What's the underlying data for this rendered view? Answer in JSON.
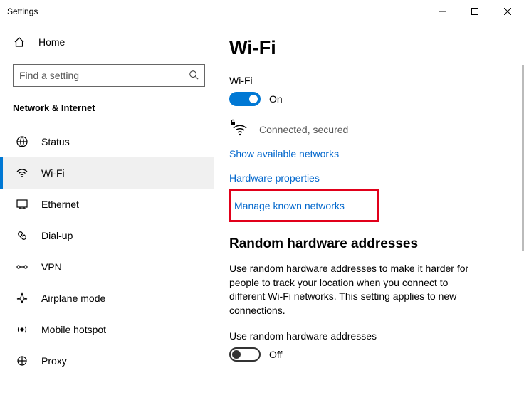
{
  "window": {
    "title": "Settings"
  },
  "sidebar": {
    "home": "Home",
    "search_placeholder": "Find a setting",
    "section": "Network & Internet",
    "items": [
      {
        "label": "Status"
      },
      {
        "label": "Wi-Fi"
      },
      {
        "label": "Ethernet"
      },
      {
        "label": "Dial-up"
      },
      {
        "label": "VPN"
      },
      {
        "label": "Airplane mode"
      },
      {
        "label": "Mobile hotspot"
      },
      {
        "label": "Proxy"
      }
    ]
  },
  "page": {
    "title": "Wi-Fi",
    "wifi_label": "Wi-Fi",
    "wifi_state": "On",
    "connection_status": "Connected, secured",
    "link_show_networks": "Show available networks",
    "link_hw_props": "Hardware properties",
    "link_manage_known": "Manage known networks",
    "random_title": "Random hardware addresses",
    "random_body": "Use random hardware addresses to make it harder for people to track your location when you connect to different Wi-Fi networks. This setting applies to new connections.",
    "random_label": "Use random hardware addresses",
    "random_state": "Off"
  }
}
